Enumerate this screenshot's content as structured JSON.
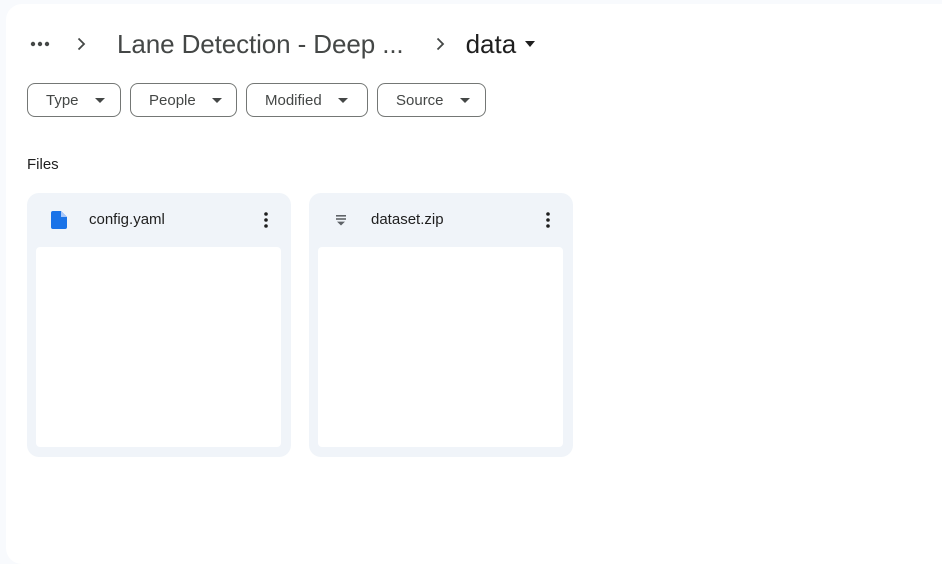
{
  "breadcrumb": {
    "more_icon": "more-horiz-icon",
    "separator_icon": "chevron-right-icon",
    "parent_label": "Lane Detection - Deep ...",
    "current_label": "data",
    "current_caret_icon": "arrow-drop-down-icon"
  },
  "filters": [
    {
      "label": "Type",
      "icon": "arrow-drop-down-icon"
    },
    {
      "label": "People",
      "icon": "arrow-drop-down-icon"
    },
    {
      "label": "Modified",
      "icon": "arrow-drop-down-icon"
    },
    {
      "label": "Source",
      "icon": "arrow-drop-down-icon"
    }
  ],
  "files_section": {
    "title": "Files",
    "items": [
      {
        "name": "config.yaml",
        "icon": "document-icon",
        "icon_color": "#1a73e8",
        "menu_icon": "more-vert-icon"
      },
      {
        "name": "dataset.zip",
        "icon": "archive-icon",
        "icon_color": "#5f6368",
        "menu_icon": "more-vert-icon"
      }
    ]
  },
  "colors": {
    "background": "#f8fafd",
    "panel": "#ffffff",
    "card": "#f0f4f9",
    "chip_border": "#747775",
    "doc_blue": "#1a73e8"
  }
}
